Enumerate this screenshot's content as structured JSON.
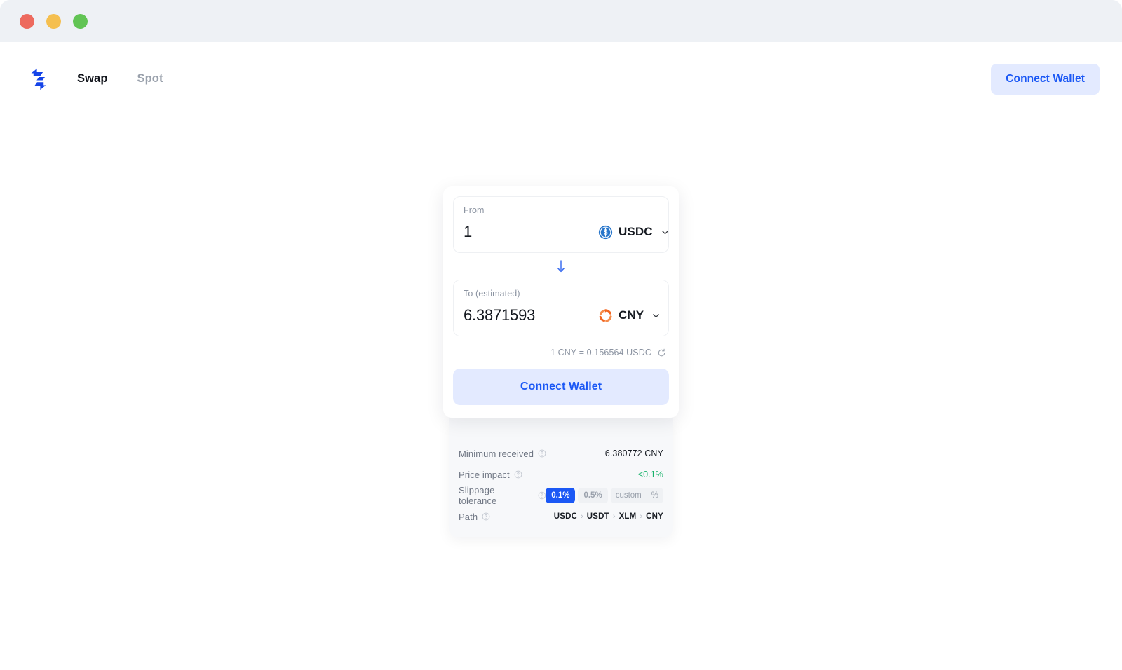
{
  "window": {
    "traffic_lights": [
      {
        "name": "close",
        "color": "#ed6a5e"
      },
      {
        "name": "minimize",
        "color": "#f5bf4f"
      },
      {
        "name": "maximize",
        "color": "#61c454"
      }
    ]
  },
  "header": {
    "logo_name": "swap-logo",
    "nav": [
      {
        "label": "Swap",
        "active": true
      },
      {
        "label": "Spot",
        "active": false
      }
    ],
    "connect_wallet_label": "Connect Wallet"
  },
  "swap": {
    "from": {
      "label": "From",
      "amount": "1",
      "placeholder": "0.0",
      "token": "USDC",
      "token_icon": "usdc-coin-icon",
      "token_icon_color": "#2775ca"
    },
    "switch_icon": "arrow-down-icon",
    "to": {
      "label": "To (estimated)",
      "amount": "6.3871593",
      "placeholder": "0.0",
      "token": "CNY",
      "token_icon": "cny-circular-arrows-icon",
      "token_icon_color": "#f26722"
    },
    "rate": {
      "text": "1 CNY = 0.156564 USDC",
      "refresh_icon": "refresh-icon"
    },
    "connect_wallet_label": "Connect Wallet"
  },
  "details": {
    "minimum_received": {
      "label": "Minimum received",
      "value": "6.380772 CNY"
    },
    "price_impact": {
      "label": "Price impact",
      "value": "<0.1%",
      "color": "#17b26a"
    },
    "slippage": {
      "label": "Slippage tolerance",
      "options": [
        "0.1%",
        "0.5%"
      ],
      "selected": "0.1%",
      "custom_placeholder": "custom",
      "custom_unit": "%"
    },
    "path": {
      "label": "Path",
      "tokens": [
        "USDC",
        "USDT",
        "XLM",
        "CNY"
      ],
      "separator": "›"
    }
  },
  "colors": {
    "accent": "#1b58f5",
    "accent_soft": "#e3eaff",
    "titlebar": "#eef1f5",
    "panel": "#f7f8fa",
    "text": "#171b22",
    "muted": "#8b93a1",
    "green": "#17b26a"
  }
}
